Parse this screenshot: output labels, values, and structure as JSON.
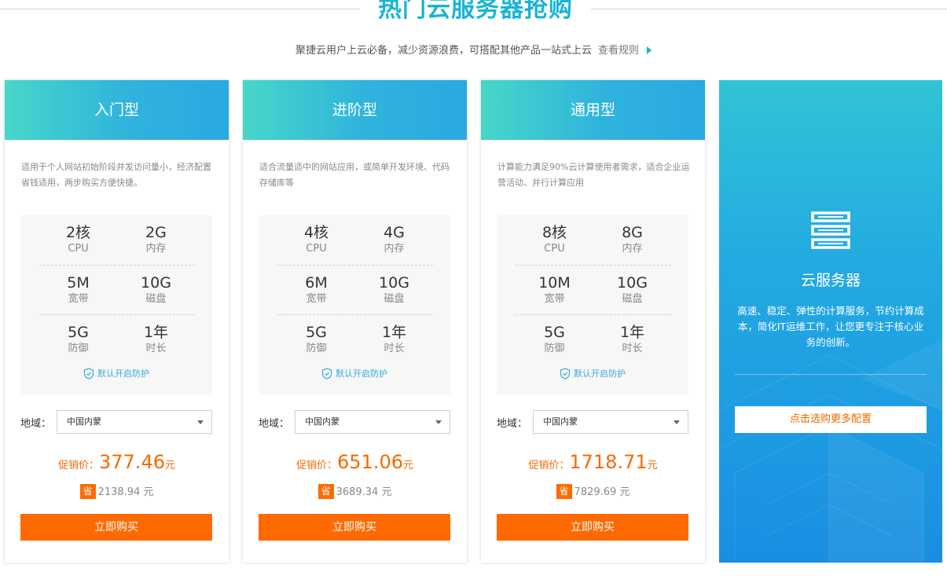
{
  "header": {
    "title": "热门云服务器抢购",
    "subtitle": "聚捷云用户上云必备，减少资源浪费，可搭配其他产品一站式上云",
    "rules_link": "查看规则"
  },
  "plans": [
    {
      "name": "入门型",
      "desc": "适用于个人网站初始阶段并发访问量小，经济配置省钱适用，两步购买方便快捷。",
      "specs": [
        {
          "value": "2核",
          "label": "CPU"
        },
        {
          "value": "2G",
          "label": "内存"
        },
        {
          "value": "5M",
          "label": "宽带"
        },
        {
          "value": "10G",
          "label": "磁盘"
        },
        {
          "value": "5G",
          "label": "防御"
        },
        {
          "value": "1年",
          "label": "时长"
        }
      ],
      "protection": "默认开启防护",
      "region_label": "地域：",
      "region_value": "中国内蒙",
      "price_label": "促销价：",
      "price": "377.46",
      "price_unit": "元",
      "save_badge": "省",
      "save_amount": "2138.94 元",
      "buy_label": "立即购买"
    },
    {
      "name": "进阶型",
      "desc": "适合流量适中的网站应用，或简单开发环境、代码存储库等",
      "specs": [
        {
          "value": "4核",
          "label": "CPU"
        },
        {
          "value": "4G",
          "label": "内存"
        },
        {
          "value": "6M",
          "label": "宽带"
        },
        {
          "value": "10G",
          "label": "磁盘"
        },
        {
          "value": "5G",
          "label": "防御"
        },
        {
          "value": "1年",
          "label": "时长"
        }
      ],
      "protection": "默认开启防护",
      "region_label": "地域：",
      "region_value": "中国内蒙",
      "price_label": "促销价：",
      "price": "651.06",
      "price_unit": "元",
      "save_badge": "省",
      "save_amount": "3689.34 元",
      "buy_label": "立即购买"
    },
    {
      "name": "通用型",
      "desc": "计算能力满足90%云计算使用者需求，适合企业运营活动、并行计算应用",
      "specs": [
        {
          "value": "8核",
          "label": "CPU"
        },
        {
          "value": "8G",
          "label": "内存"
        },
        {
          "value": "10M",
          "label": "宽带"
        },
        {
          "value": "10G",
          "label": "磁盘"
        },
        {
          "value": "5G",
          "label": "防御"
        },
        {
          "value": "1年",
          "label": "时长"
        }
      ],
      "protection": "默认开启防护",
      "region_label": "地域：",
      "region_value": "中国内蒙",
      "price_label": "促销价：",
      "price": "1718.71",
      "price_unit": "元",
      "save_badge": "省",
      "save_amount": "7829.69 元",
      "buy_label": "立即购买"
    }
  ],
  "promo": {
    "icon": "server-icon",
    "title": "云服务器",
    "desc": "高速、稳定、弹性的计算服务，节约计算成本，简化IT运维工作，让您更专注于核心业务的创新。",
    "button_label": "点击选购更多配置"
  },
  "colors": {
    "accent_teal": "#18b4d4",
    "header_gradient_start": "#47d7c9",
    "header_gradient_end": "#29a9e1",
    "price_orange": "#f46a00",
    "button_orange": "#ff6a00",
    "promo_blue": "#1a8ee2"
  }
}
